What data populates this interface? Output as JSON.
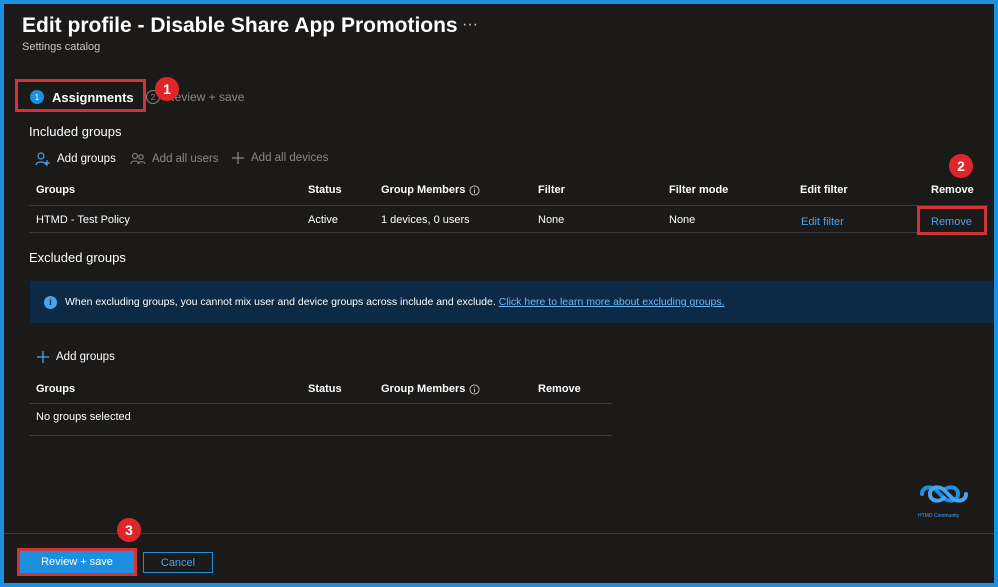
{
  "header": {
    "title": "Edit profile - Disable Share App Promotions",
    "more_label": "···",
    "subtitle": "Settings catalog"
  },
  "tabs": [
    {
      "step": "1",
      "label": "Assignments",
      "active": true
    },
    {
      "step": "2",
      "label": "Review + save",
      "active": false
    }
  ],
  "callouts": {
    "one": "1",
    "two": "2",
    "three": "3"
  },
  "included": {
    "title": "Included groups",
    "commands": [
      {
        "label": "Add groups",
        "icon": "add-person-icon",
        "enabled": true
      },
      {
        "label": "Add all users",
        "icon": "people-icon",
        "enabled": false
      },
      {
        "label": "Add all devices",
        "icon": "plus-icon",
        "enabled": false
      }
    ],
    "columns": [
      "Groups",
      "Status",
      "Group Members",
      "Filter",
      "Filter mode",
      "Edit filter",
      "Remove"
    ],
    "rows": [
      {
        "group": "HTMD - Test Policy",
        "status": "Active",
        "members": "1 devices, 0 users",
        "filter": "None",
        "filter_mode": "None",
        "edit_filter": "Edit filter",
        "remove": "Remove"
      }
    ]
  },
  "excluded": {
    "title": "Excluded groups",
    "info_text": "When excluding groups, you cannot mix user and device groups across include and exclude.",
    "info_link": "Click here to learn more about excluding groups.",
    "add_label": "Add groups",
    "columns": [
      "Groups",
      "Status",
      "Group Members",
      "Remove"
    ],
    "empty": "No groups selected"
  },
  "footer": {
    "primary": "Review + save",
    "cancel": "Cancel"
  },
  "watermark": {
    "text": "HTMD Community"
  },
  "colors": {
    "accent": "#1d8fe0",
    "callout": "#e0262a",
    "background": "#1b1a19",
    "info_bar": "#0c2a46"
  }
}
